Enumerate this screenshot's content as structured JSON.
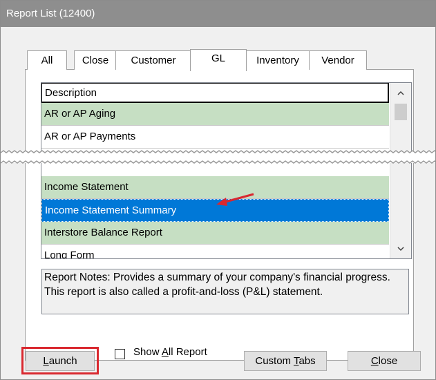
{
  "window": {
    "title": "Report List (12400)"
  },
  "tabs": [
    {
      "label": "All"
    },
    {
      "label": "Close"
    },
    {
      "label": "Customer"
    },
    {
      "label": "GL",
      "active": true
    },
    {
      "label": "Inventory"
    },
    {
      "label": "Vendor"
    }
  ],
  "list": {
    "header": "Description",
    "rows": [
      {
        "label": "AR or AP Aging",
        "style": "green"
      },
      {
        "label": "AR or AP Payments",
        "style": "white"
      },
      {
        "label": "Income Statement",
        "style": "green"
      },
      {
        "label": "Income Statement Summary",
        "style": "selected"
      },
      {
        "label": "Interstore Balance Report",
        "style": "green"
      },
      {
        "label": "Long Form",
        "style": "white"
      }
    ]
  },
  "notes": {
    "text": "Report Notes:  Provides a summary of your company's financial progress. This report is also called a profit-and-loss (P&L) statement."
  },
  "buttons": {
    "launch": {
      "pre": "",
      "mn": "L",
      "post": "aunch"
    },
    "custom_tabs": {
      "pre": "Custom ",
      "mn": "T",
      "post": "abs"
    },
    "close": {
      "pre": "",
      "mn": "C",
      "post": "lose"
    }
  },
  "checkbox": {
    "pre": "Show ",
    "mn": "A",
    "post": "ll Report",
    "checked": false
  },
  "colors": {
    "row_green": "#c6dfc3",
    "selected": "#0078d7",
    "highlight_box": "#d9282f",
    "arrow": "#d9282f"
  },
  "icons": [
    "scroll-up-icon",
    "scroll-down-icon",
    "annotation-arrow-icon"
  ]
}
